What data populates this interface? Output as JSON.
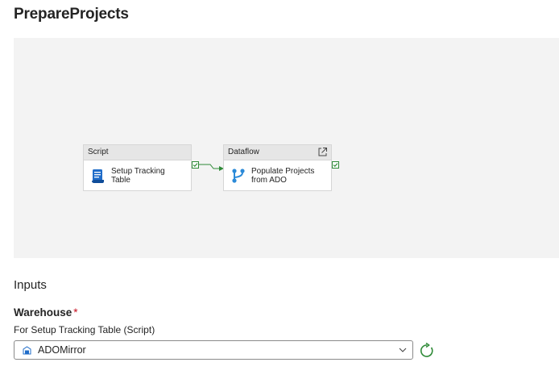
{
  "page": {
    "title": "PrepareProjects"
  },
  "pipeline": {
    "nodes": [
      {
        "type_label": "Script",
        "label_line1": "Setup Tracking",
        "label_line2": "Table",
        "icon": "script-icon",
        "status": "succeeded"
      },
      {
        "type_label": "Dataflow",
        "label_line1": "Populate Projects",
        "label_line2": "from ADO",
        "icon": "dataflow-icon",
        "status": "succeeded",
        "has_open_link": true
      }
    ],
    "connector_color": "#2e8a37"
  },
  "inputs": {
    "section_title": "Inputs",
    "warehouse": {
      "label": "Warehouse",
      "required_marker": "*",
      "sublabel": "For Setup Tracking Table (Script)",
      "selected_value": "ADOMirror",
      "icon": "warehouse-icon"
    }
  },
  "colors": {
    "canvas_bg": "#f3f3f3",
    "success_green": "#2e8a37",
    "script_icon_blue": "#1f6cc9",
    "dataflow_icon_blue": "#2b8ad8",
    "required_red": "#c50f1f"
  }
}
